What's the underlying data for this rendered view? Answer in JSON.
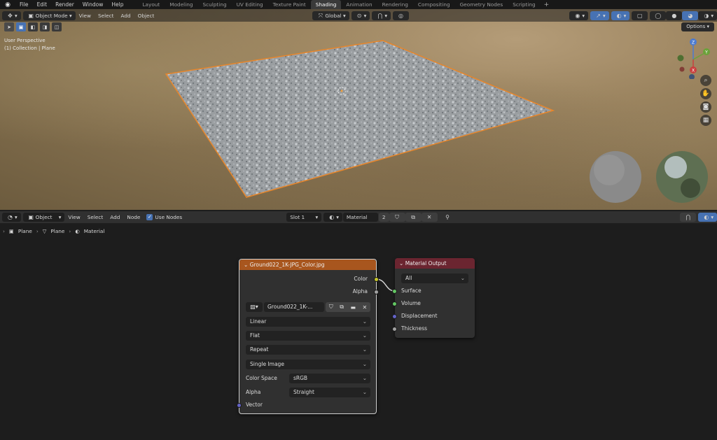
{
  "top_menu": {
    "items": [
      "File",
      "Edit",
      "Render",
      "Window",
      "Help"
    ],
    "workspaces": [
      "Layout",
      "Modeling",
      "Sculpting",
      "UV Editing",
      "Texture Paint",
      "Shading",
      "Animation",
      "Rendering",
      "Compositing",
      "Geometry Nodes",
      "Scripting"
    ],
    "active_workspace": "Shading",
    "add_label": "+"
  },
  "viewport": {
    "mode": "Object Mode",
    "menus": [
      "View",
      "Select",
      "Add",
      "Object"
    ],
    "transform_orientation": "Global",
    "options_label": "Options",
    "perspective_label": "User Perspective",
    "collection_label": "(1) Collection | Plane",
    "gizmo": {
      "z": "Z",
      "y": "Y",
      "x": "X"
    }
  },
  "node_editor": {
    "object_dropdown": "Object",
    "menus": [
      "View",
      "Select",
      "Add",
      "Node"
    ],
    "use_nodes_label": "Use Nodes",
    "use_nodes_checked": true,
    "slot": "Slot 1",
    "material_name": "Material",
    "user_count": "2",
    "breadcrumb": [
      "Plane",
      "Plane",
      "Material"
    ]
  },
  "image_node": {
    "title": "Ground022_1K-JPG_Color.jpg",
    "outputs": [
      "Color",
      "Alpha"
    ],
    "image_name": "Ground022_1K-...",
    "interpolation": "Linear",
    "projection": "Flat",
    "extension": "Repeat",
    "source": "Single Image",
    "color_space_label": "Color Space",
    "color_space": "sRGB",
    "alpha_label": "Alpha",
    "alpha_mode": "Straight",
    "vector_label": "Vector"
  },
  "output_node": {
    "title": "Material Output",
    "target": "All",
    "inputs": [
      "Surface",
      "Volume",
      "Displacement",
      "Thickness"
    ]
  },
  "colors": {
    "image_node_header": "#a8561e",
    "output_node_header": "#6b2530",
    "color_socket": "#c7c729",
    "alpha_socket": "#a1a1a1",
    "shader_socket": "#63c763",
    "vector_socket": "#6363c7",
    "selection_outline": "#e8862a"
  }
}
